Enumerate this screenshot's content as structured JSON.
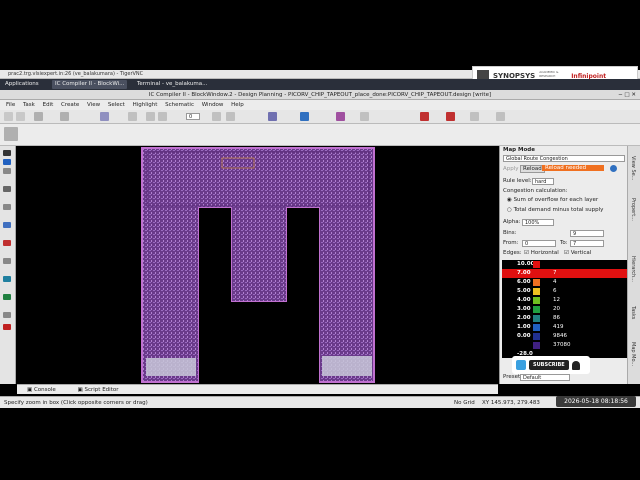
{
  "vnc": {
    "title": "prac2.trg.vlsiexpert.in:26 (ve_balakumara) - TigerVNC"
  },
  "taskbar": {
    "applications": "Applications",
    "items": [
      "IC Compiler II - BlockWi...",
      "Terminal - ve_balakuma..."
    ]
  },
  "logo": {
    "brand": "SYNOPSYS",
    "partner": "Infinipoint",
    "sub": "ACADEMIC & RESEARCH ALLIANCE"
  },
  "window": {
    "title": "IC Compiler II - BlockWindow.2 - Design Planning - PICORV_CHIP_TAPEOUT_place_done:PICORV_CHIP_TAPEOUT.design [write]"
  },
  "menu": [
    "File",
    "Task",
    "Edit",
    "Create",
    "View",
    "Select",
    "Highlight",
    "Schematic",
    "Window",
    "Help"
  ],
  "toolbar": {
    "zoom_value": "0"
  },
  "map_panel": {
    "header": "Map Mode",
    "mode": "Global Route Congestion",
    "apply": "Apply",
    "reload": "Reload",
    "reload_needed": "Reload needed",
    "rule_level_label": "Rule level:",
    "rule_level_value": "hard",
    "calc_label": "Congestion calculation:",
    "calc_opt1": "Sum of overflow for each layer",
    "calc_opt2": "Total demand minus total supply",
    "alpha_label": "Alpha:",
    "alpha_value": "100%",
    "bins_label": "Bins:",
    "bins_value": "9",
    "from_label": "From:",
    "from_value": "0",
    "to_label": "To:",
    "to_value": "7",
    "edges_label": "Edges:",
    "edges_h": "Horizontal",
    "edges_v": "Vertical",
    "preset_label": "Preset:",
    "preset_value": "Default",
    "legend": [
      {
        "value": "10.00",
        "count": "",
        "color": "#e01010"
      },
      {
        "value": "7.00",
        "count": "7",
        "color": "#e01010"
      },
      {
        "value": "6.00",
        "count": "4",
        "color": "#f07020"
      },
      {
        "value": "5.00",
        "count": "6",
        "color": "#f0c020"
      },
      {
        "value": "4.00",
        "count": "12",
        "color": "#70c020"
      },
      {
        "value": "3.00",
        "count": "20",
        "color": "#20a040"
      },
      {
        "value": "2.00",
        "count": "86",
        "color": "#208080"
      },
      {
        "value": "1.00",
        "count": "419",
        "color": "#2060c0"
      },
      {
        "value": "0.00",
        "count": "9846",
        "color": "#203090"
      },
      {
        "value": "",
        "count": "37080",
        "color": "#402080"
      },
      {
        "value": "-28.00",
        "count": "",
        "color": "#000000"
      }
    ]
  },
  "right_tabs": [
    "View Se...",
    "Propert...",
    "Hierarch...",
    "Tasks",
    "Map Mo..."
  ],
  "bottom_tabs": [
    "Console",
    "Script Editor"
  ],
  "status": {
    "message": "Specify zoom in box (Click opposite corners or drag)",
    "grid": "No Grid",
    "coords": "XY 145.973, 279.483"
  },
  "timestamp": "2026-05-18  08:18:56",
  "subscribe": "SUBSCRIBE"
}
